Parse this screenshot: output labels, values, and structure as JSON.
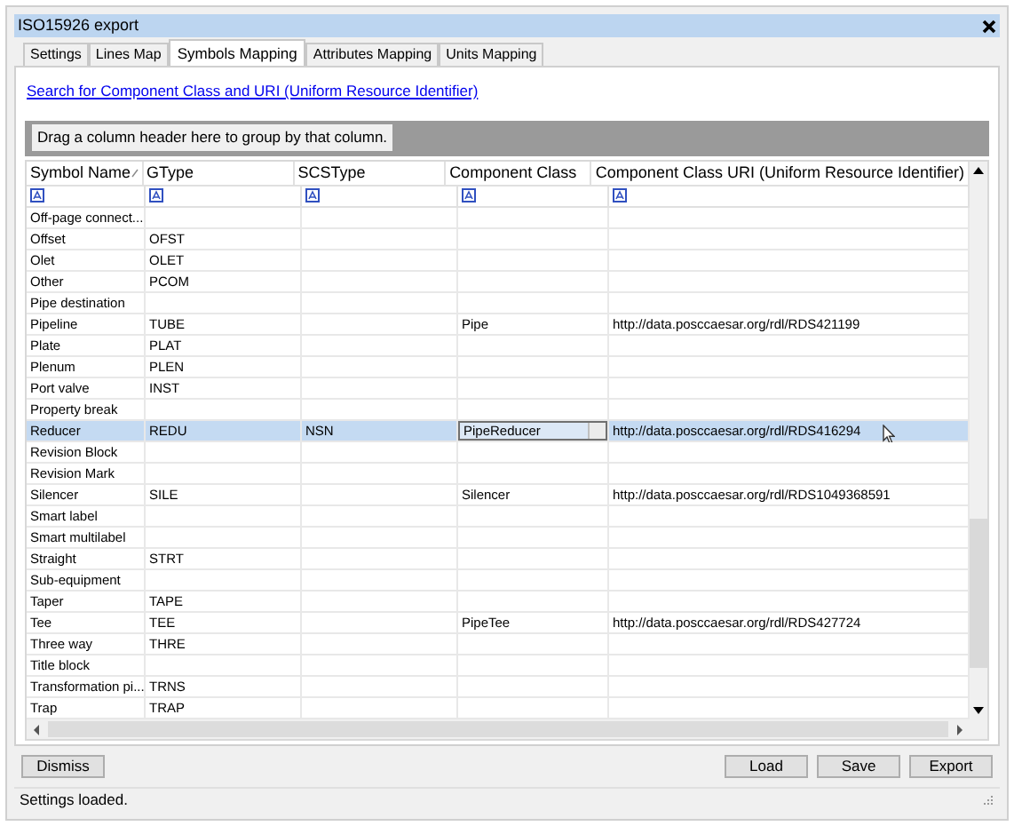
{
  "window": {
    "title": "ISO15926 export"
  },
  "tabs": [
    {
      "label": "Settings",
      "selected": false
    },
    {
      "label": "Lines Map",
      "selected": false
    },
    {
      "label": "Symbols Mapping",
      "selected": true
    },
    {
      "label": "Attributes Mapping",
      "selected": false
    },
    {
      "label": "Units Mapping",
      "selected": false
    }
  ],
  "search_link": "Search for Component Class and URI (Uniform Resource Identifier)",
  "group_panel": "Drag a column header here to group by that column.",
  "table": {
    "columns": [
      "Symbol Name",
      "GType",
      "SCSType",
      "Component Class",
      "Component Class URI (Uniform Resource Identifier)"
    ],
    "rows": [
      {
        "cells": [
          "Off-page connect...",
          "",
          "",
          "",
          ""
        ],
        "selected": false
      },
      {
        "cells": [
          "Offset",
          "OFST",
          "",
          "",
          ""
        ],
        "selected": false
      },
      {
        "cells": [
          "Olet",
          "OLET",
          "",
          "",
          ""
        ],
        "selected": false
      },
      {
        "cells": [
          "Other",
          "PCOM",
          "",
          "",
          ""
        ],
        "selected": false
      },
      {
        "cells": [
          "Pipe destination",
          "",
          "",
          "",
          ""
        ],
        "selected": false
      },
      {
        "cells": [
          "Pipeline",
          "TUBE",
          "",
          "Pipe",
          "http://data.posccaesar.org/rdl/RDS421199"
        ],
        "selected": false
      },
      {
        "cells": [
          "Plate",
          "PLAT",
          "",
          "",
          ""
        ],
        "selected": false
      },
      {
        "cells": [
          "Plenum",
          "PLEN",
          "",
          "",
          ""
        ],
        "selected": false
      },
      {
        "cells": [
          "Port valve",
          "INST",
          "",
          "",
          ""
        ],
        "selected": false
      },
      {
        "cells": [
          "Property break",
          "",
          "",
          "",
          ""
        ],
        "selected": false
      },
      {
        "cells": [
          "Reducer",
          "REDU",
          "NSN",
          "PipeReducer",
          "http://data.posccaesar.org/rdl/RDS416294"
        ],
        "selected": true
      },
      {
        "cells": [
          "Revision Block",
          "",
          "",
          "",
          ""
        ],
        "selected": false
      },
      {
        "cells": [
          "Revision Mark",
          "",
          "",
          "",
          ""
        ],
        "selected": false
      },
      {
        "cells": [
          "Silencer",
          "SILE",
          "",
          "Silencer",
          "http://data.posccaesar.org/rdl/RDS1049368591"
        ],
        "selected": false
      },
      {
        "cells": [
          "Smart label",
          "",
          "",
          "",
          ""
        ],
        "selected": false
      },
      {
        "cells": [
          "Smart multilabel",
          "",
          "",
          "",
          ""
        ],
        "selected": false
      },
      {
        "cells": [
          "Straight",
          "STRT",
          "",
          "",
          ""
        ],
        "selected": false
      },
      {
        "cells": [
          "Sub-equipment",
          "",
          "",
          "",
          ""
        ],
        "selected": false
      },
      {
        "cells": [
          "Taper",
          "TAPE",
          "",
          "",
          ""
        ],
        "selected": false
      },
      {
        "cells": [
          "Tee",
          "TEE",
          "",
          "PipeTee",
          "http://data.posccaesar.org/rdl/RDS427724"
        ],
        "selected": false
      },
      {
        "cells": [
          "Three way",
          "THRE",
          "",
          "",
          ""
        ],
        "selected": false
      },
      {
        "cells": [
          "Title block",
          "",
          "",
          "",
          ""
        ],
        "selected": false
      },
      {
        "cells": [
          "Transformation pi...",
          "TRNS",
          "",
          "",
          ""
        ],
        "selected": false
      },
      {
        "cells": [
          "Trap",
          "TRAP",
          "",
          "",
          ""
        ],
        "selected": false
      }
    ]
  },
  "left_buttons": [
    "Dismiss"
  ],
  "right_buttons": [
    "Load",
    "Save",
    "Export"
  ],
  "status_bar": "Settings loaded."
}
